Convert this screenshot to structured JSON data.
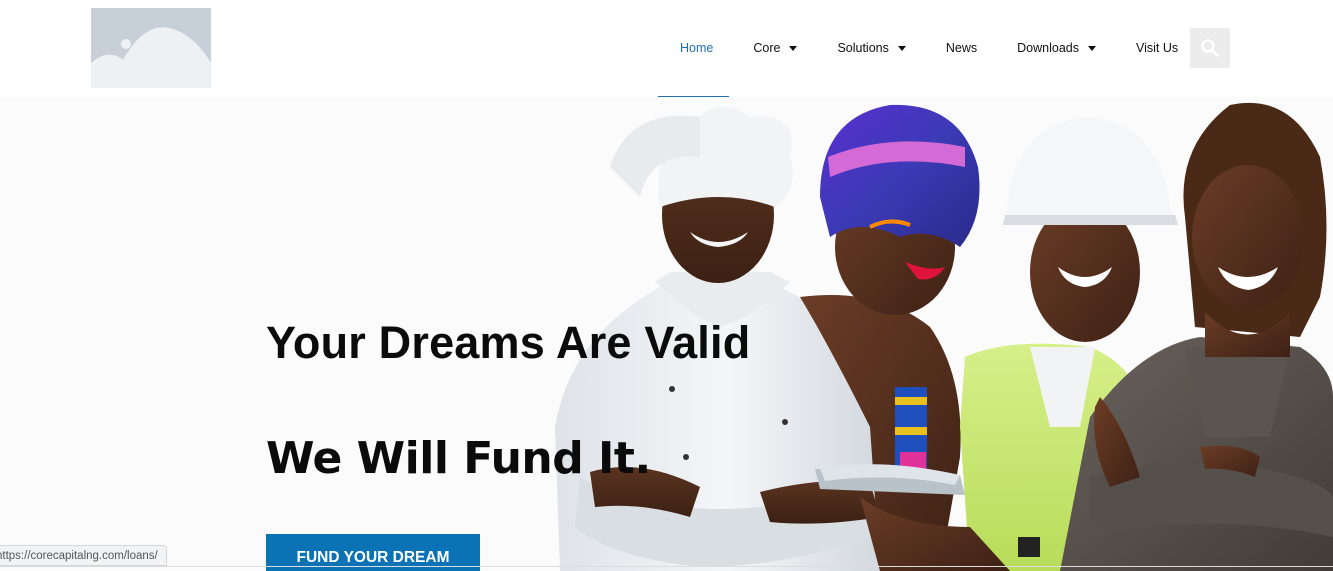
{
  "header": {
    "logo_icon": "image-placeholder-icon",
    "search_icon": "search-icon"
  },
  "nav": {
    "items": [
      {
        "label": "Home",
        "active": true,
        "dropdown": false
      },
      {
        "label": "Core",
        "active": false,
        "dropdown": true
      },
      {
        "label": "Solutions",
        "active": false,
        "dropdown": true
      },
      {
        "label": "News",
        "active": false,
        "dropdown": false
      },
      {
        "label": "Downloads",
        "active": false,
        "dropdown": true
      },
      {
        "label": "Visit Us",
        "active": false,
        "dropdown": false
      }
    ]
  },
  "hero": {
    "headline": "Your Dreams Are Valid",
    "subheadline": "We Will Fund It.",
    "cta_label": "FUND YOUR DREAM",
    "image_alt_icon": "people-group-photo"
  },
  "status_bar": {
    "url": "https://corecapitalng.com/loans/"
  },
  "colors": {
    "accent": "#1f6fb0",
    "cta_bg": "#0b72b5",
    "text": "#0b0b0b",
    "logo_bg": "#c7d0d8"
  }
}
